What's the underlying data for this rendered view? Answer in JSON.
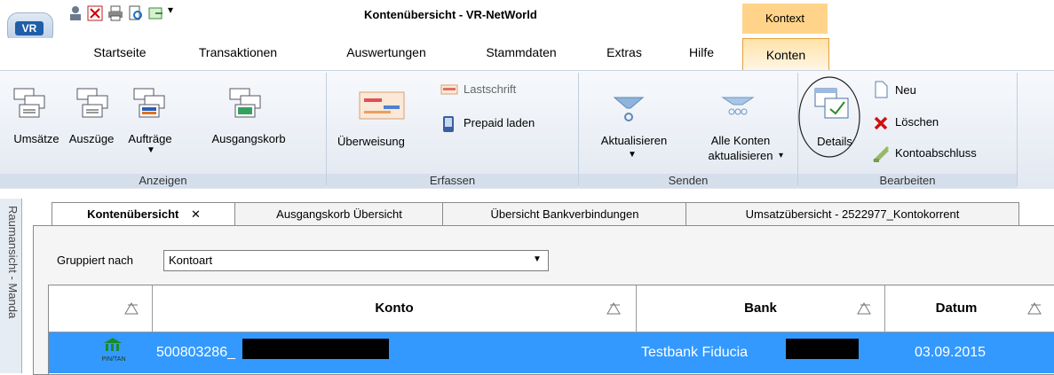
{
  "window": {
    "title": "Kontenübersicht - VR-NetWorld",
    "context_tab": "Kontext"
  },
  "ribbon_tabs": [
    "Startseite",
    "Transaktionen",
    "Auswertungen",
    "Stammdaten",
    "Extras",
    "Hilfe",
    "Konten"
  ],
  "groups": {
    "anzeigen": {
      "label": "Anzeigen",
      "buttons": [
        "Umsätze",
        "Auszüge",
        "Aufträge",
        "Ausgangskorb"
      ]
    },
    "erfassen": {
      "label": "Erfassen",
      "buttons": [
        "Überweisung",
        "Lastschrift",
        "Prepaid laden"
      ]
    },
    "senden": {
      "label": "Senden",
      "buttons": [
        "Aktualisieren",
        "Alle Konten",
        "aktualisieren"
      ]
    },
    "bearbeiten": {
      "label": "Bearbeiten",
      "buttons": [
        "Details",
        "Neu",
        "Löschen",
        "Kontoabschluss"
      ]
    }
  },
  "side_panel": "Raumansicht - Manda",
  "doc_tabs": [
    "Kontenübersicht",
    "Ausgangskorb Übersicht",
    "Übersicht Bankverbindungen",
    "Umsatzübersicht - 2522977_Kontokorrent"
  ],
  "grouping": {
    "label": "Gruppiert nach",
    "value": "Kontoart"
  },
  "grid": {
    "columns": [
      "Konto",
      "Bank",
      "Datum"
    ],
    "rows": [
      {
        "account": "500803286_",
        "bank": "Testbank Fiducia",
        "date": "03.09.2015",
        "icon_text": "PIN/TAN"
      }
    ]
  },
  "colors": {
    "selection": "#3399ff",
    "context_tab": "#ffd48a",
    "ribbon": "#e2e8f1"
  }
}
